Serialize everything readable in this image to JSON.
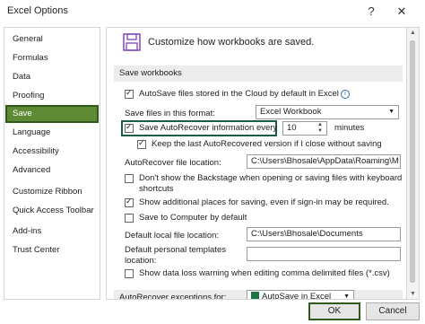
{
  "window": {
    "title": "Excel Options",
    "help": "?",
    "close": "✕"
  },
  "sidebar": {
    "items": [
      {
        "label": "General"
      },
      {
        "label": "Formulas"
      },
      {
        "label": "Data"
      },
      {
        "label": "Proofing"
      },
      {
        "label": "Save",
        "selected": true
      },
      {
        "label": "Language"
      },
      {
        "label": "Accessibility"
      },
      {
        "label": "Advanced"
      },
      {
        "label": "Customize Ribbon"
      },
      {
        "label": "Quick Access Toolbar"
      },
      {
        "label": "Add-ins"
      },
      {
        "label": "Trust Center"
      }
    ]
  },
  "main": {
    "header": "Customize how workbooks are saved.",
    "section_save": "Save workbooks",
    "autosave_cloud": "AutoSave files stored in the Cloud by default in Excel",
    "save_format_label": "Save files in this format:",
    "save_format_value": "Excel Workbook",
    "autorecover_label": "Save AutoRecover information every",
    "autorecover_minutes": "10",
    "minutes_label": "minutes",
    "keep_last_label": "Keep the last AutoRecovered version if I close without saving",
    "autorecover_location_label": "AutoRecover file location:",
    "autorecover_location_value": "C:\\Users\\Bhosale\\AppData\\Roaming\\M",
    "dont_show_backstage": "Don't show the Backstage when opening or saving files with keyboard shortcuts",
    "show_additional_places": "Show additional places for saving, even if sign-in may be required.",
    "save_to_computer": "Save to Computer by default",
    "default_local_label": "Default local file location:",
    "default_local_value": "C:\\Users\\Bhosale\\Documents",
    "default_personal_label": "Default personal templates location:",
    "default_personal_value": "",
    "show_data_loss": "Show data loss warning when editing comma delimited files (*.csv)",
    "section_autorecover_exceptions": "AutoRecover exceptions for:",
    "exceptions_value": "AutoSave in Excel"
  },
  "footer": {
    "ok": "OK",
    "cancel": "Cancel"
  },
  "colors": {
    "selected_nav": "#5e8a35",
    "highlight_border": "#1e5a4a",
    "save_icon": "#8a4fbf"
  }
}
